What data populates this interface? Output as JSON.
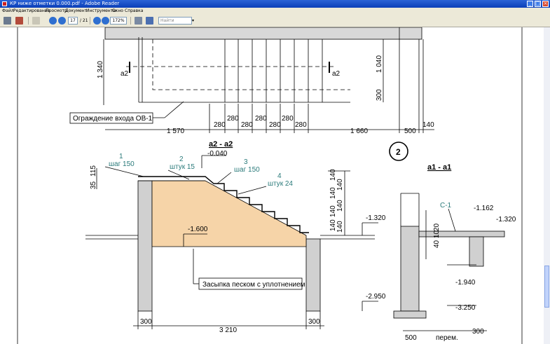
{
  "window": {
    "title": "КР ниже отметки 0.000.pdf - Adobe Reader"
  },
  "menu": {
    "items": [
      "Файл",
      "Редактирование",
      "Просмотр",
      "Документ",
      "Инструменты",
      "Окно",
      "Справка"
    ]
  },
  "toolbar": {
    "page_current": "17",
    "page_total": "/ 21",
    "zoom": "172%",
    "search_placeholder": "Найти"
  },
  "drawing": {
    "top": {
      "dims_vertical": [
        "1 340",
        "1 040",
        "300"
      ],
      "section_marker": "a2",
      "fence_label": "Ограждение входа ОВ-1",
      "dims_bottom": [
        "1 570",
        "280",
        "280",
        "280",
        "280",
        "280",
        "280",
        "280",
        "1 660",
        "500",
        "140"
      ]
    },
    "section_a2": {
      "title": "a2  -  a2",
      "marks": [
        {
          "n": "1",
          "t": "шаг 150"
        },
        {
          "n": "2",
          "t": "штук 15"
        },
        {
          "n": "3",
          "t": "шаг 150"
        },
        {
          "n": "4",
          "t": "штук 24"
        }
      ],
      "levels": [
        "-0.040",
        "-1.320",
        "-1.600",
        "-2.950"
      ],
      "left_dims": [
        "35",
        "115"
      ],
      "right_dims": [
        "140",
        "140",
        "140",
        "140",
        "140",
        "140",
        "140"
      ],
      "fill_label": "Засыпка песком с уплотнением",
      "bottom_dims": [
        "300",
        "3 210",
        "300"
      ]
    },
    "callout": "2",
    "section_a1": {
      "title": "a1  -  a1",
      "mark": "С-1",
      "levels": [
        "-1.162",
        "-1.320",
        "-1.940",
        "-3.250"
      ],
      "dims": [
        "20",
        "10",
        "40"
      ],
      "bottom": [
        "500",
        "перем.",
        "300"
      ]
    }
  }
}
